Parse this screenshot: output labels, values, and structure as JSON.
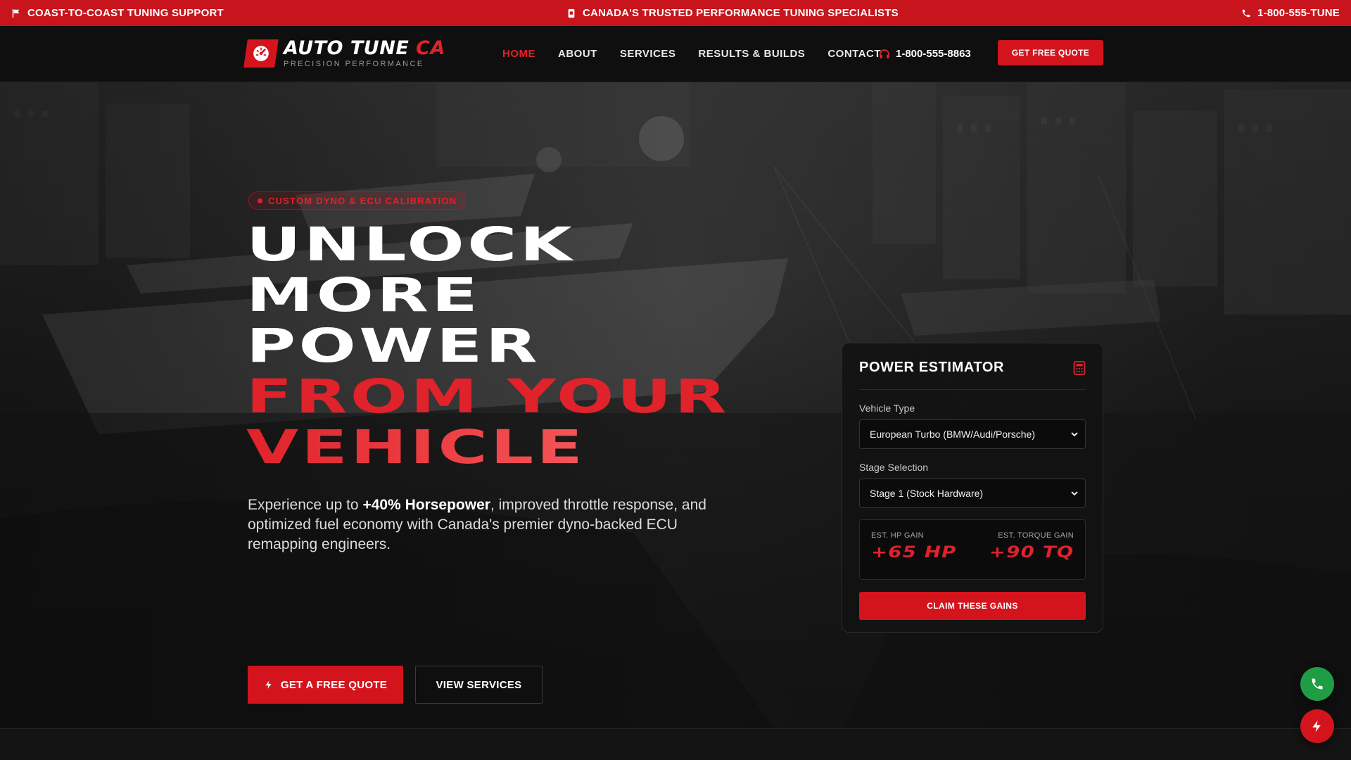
{
  "topbar": {
    "left_text": "COAST-TO-COAST TUNING SUPPORT",
    "left_icon": "flag-icon",
    "center_text": "CANADA'S TRUSTED PERFORMANCE TUNING SPECIALISTS",
    "center_icon": "badge-icon",
    "right_text": "1-800-555-TUNE",
    "right_icon": "phone-icon",
    "background": "#c8141d"
  },
  "nav": {
    "logo_main": "AUTO TUNE",
    "logo_accent": "CA",
    "logo_sub": "PRECISION PERFORMANCE",
    "logo_icon": "speedometer-icon",
    "menu": [
      {
        "label": "HOME",
        "active": true
      },
      {
        "label": "ABOUT",
        "active": false
      },
      {
        "label": "SERVICES",
        "active": false
      },
      {
        "label": "RESULTS & BUILDS",
        "active": false
      },
      {
        "label": "CONTACT",
        "active": false
      }
    ],
    "phone": "1-800-555-8863",
    "phone_icon": "headset-icon",
    "quote_button": "GET FREE QUOTE"
  },
  "hero": {
    "badge": "CUSTOM DYNO & ECU CALIBRATION",
    "headline_white": [
      "UNLOCK",
      "MORE",
      "POWER"
    ],
    "headline_red": [
      "FROM YOUR",
      "VEHICLE"
    ],
    "lead_before": "Experience up to ",
    "lead_bold": "+40% Horsepower",
    "lead_after": ", improved throttle response, and optimized fuel economy with Canada's premier dyno-backed ECU remapping engineers.",
    "primary_button": "GET A FREE QUOTE",
    "primary_icon": "lightning-icon",
    "secondary_button": "VIEW SERVICES"
  },
  "estimator": {
    "title": "POWER ESTIMATOR",
    "title_icon": "calculator-icon",
    "vehicle_label": "Vehicle Type",
    "vehicle_value": "European Turbo (BMW/Audi/Porsche)",
    "stage_label": "Stage Selection",
    "stage_value": "Stage 1 (Stock Hardware)",
    "hp_label": "EST. HP GAIN",
    "hp_value": "+65 HP",
    "tq_label": "EST. TORQUE GAIN",
    "tq_value": "+90 TQ",
    "claim_button": "CLAIM THESE GAINS"
  },
  "floating": {
    "call_icon": "phone-icon",
    "call_color": "#1f9d45",
    "bolt_icon": "lightning-icon",
    "bolt_color": "#d4141d"
  },
  "colors": {
    "accent": "#e0222b",
    "brand_red": "#d4141d",
    "background": "#141414"
  }
}
